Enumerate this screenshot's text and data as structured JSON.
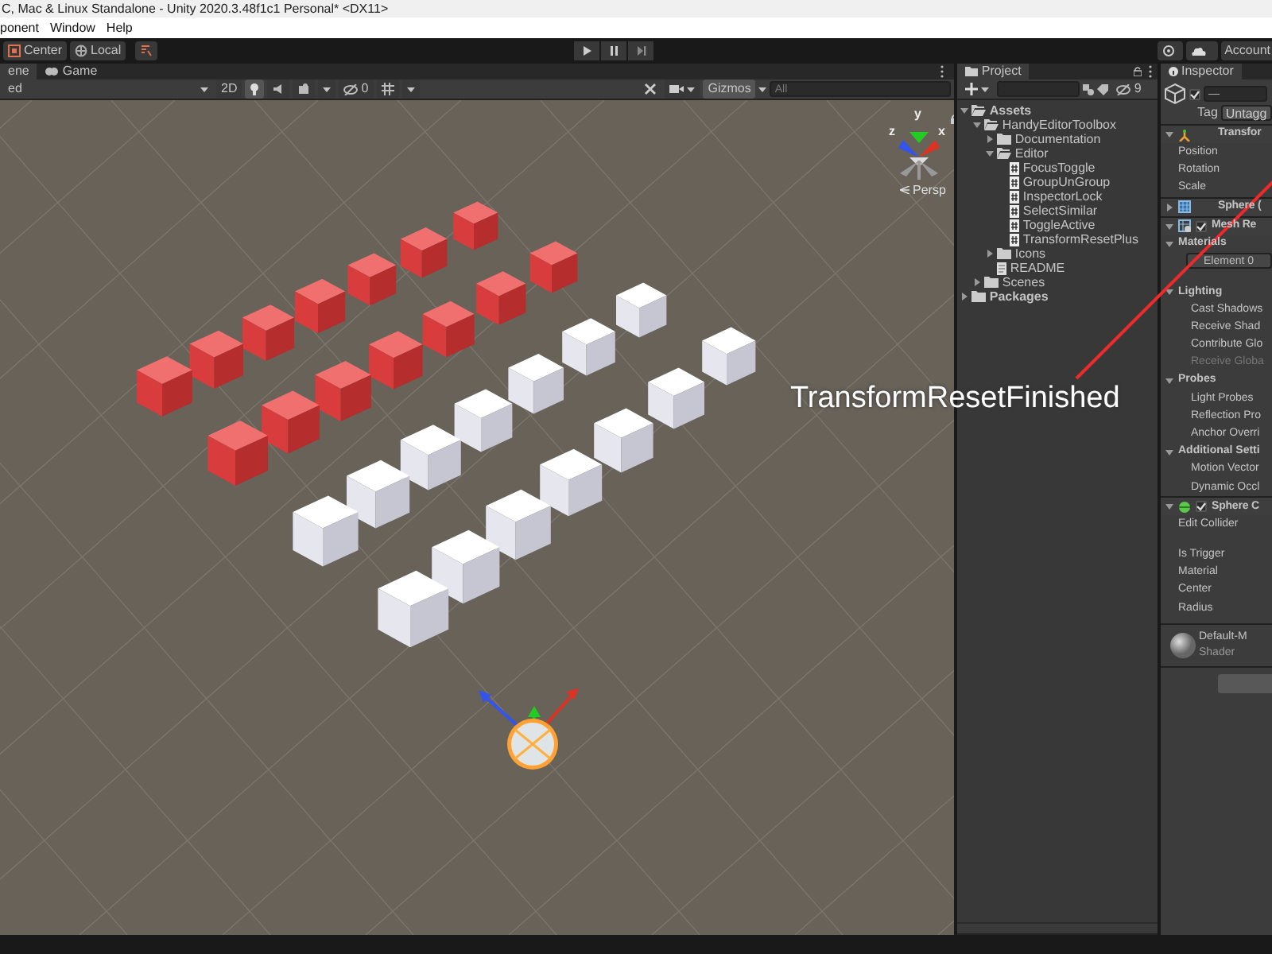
{
  "window": {
    "title": "C, Mac & Linux Standalone - Unity 2020.3.48f1c1 Personal* <DX11>"
  },
  "menu": [
    "ponent",
    "Window",
    "Help"
  ],
  "toolbar": {
    "pivot_buttons": [
      "Center",
      "Local"
    ],
    "account": "Account"
  },
  "scene_tabs": [
    {
      "label": "ene",
      "selected": true
    },
    {
      "label": "Game",
      "selected": false
    }
  ],
  "scene_toolbar": {
    "shading": "ed",
    "mode_2d": "2D",
    "hidden_count": "0",
    "gizmos": "Gizmos",
    "search": {
      "placeholder": "All"
    },
    "toggles": [
      {
        "kind": "lighting",
        "on": true
      },
      {
        "kind": "audio",
        "on": false
      },
      {
        "kind": "effects",
        "on": false
      },
      {
        "kind": "hidden",
        "on": false
      },
      {
        "kind": "grid",
        "on": false
      }
    ]
  },
  "scene_view": {
    "projection": "Persp",
    "axes": [
      "y",
      "z",
      "x"
    ]
  },
  "annotation": {
    "text": "TransformResetFinished"
  },
  "project": {
    "title": "Project",
    "hidden_count": "9",
    "tree": [
      {
        "label": "Assets",
        "kind": "folder",
        "expanded": true,
        "children": [
          {
            "label": "HandyEditorToolbox",
            "kind": "folder",
            "expanded": true,
            "children": [
              {
                "label": "Documentation",
                "kind": "folder",
                "expanded": false
              },
              {
                "label": "Editor",
                "kind": "folder",
                "expanded": true,
                "children": [
                  {
                    "label": "FocusToggle",
                    "kind": "script"
                  },
                  {
                    "label": "GroupUnGroup",
                    "kind": "script"
                  },
                  {
                    "label": "InspectorLock",
                    "kind": "script"
                  },
                  {
                    "label": "SelectSimilar",
                    "kind": "script"
                  },
                  {
                    "label": "ToggleActive",
                    "kind": "script"
                  },
                  {
                    "label": "TransformResetPlus",
                    "kind": "script"
                  }
                ]
              },
              {
                "label": "Icons",
                "kind": "folder",
                "expanded": false
              },
              {
                "label": "README",
                "kind": "doc"
              }
            ]
          },
          {
            "label": "Scenes",
            "kind": "folder",
            "expanded": false
          }
        ]
      },
      {
        "label": "Packages",
        "kind": "folder",
        "expanded": false
      }
    ]
  },
  "inspector": {
    "title": "Inspector",
    "active": true,
    "name_value": "—",
    "tag_label": "Tag",
    "tag_value": "Untagg",
    "rows": [
      {
        "kind": "component",
        "label": "Transfor",
        "expanded": true
      },
      {
        "kind": "property",
        "label": "Position",
        "disabled": false
      },
      {
        "kind": "property",
        "label": "Rotation",
        "disabled": false
      },
      {
        "kind": "property",
        "label": "Scale",
        "disabled": false
      },
      {
        "kind": "component",
        "label": "Sphere (",
        "expanded": false
      },
      {
        "kind": "component",
        "label": "Mesh Re",
        "expanded": true,
        "enabled": true
      },
      {
        "kind": "section",
        "label": "Materials",
        "expanded": true
      },
      {
        "kind": "element",
        "label": "Element 0"
      },
      {
        "kind": "section",
        "label": "Lighting",
        "expanded": true
      },
      {
        "kind": "property",
        "label": "Cast Shadows",
        "disabled": false
      },
      {
        "kind": "property",
        "label": "Receive Shad",
        "disabled": false
      },
      {
        "kind": "property",
        "label": "Contribute Glo",
        "disabled": false
      },
      {
        "kind": "property",
        "label": "Receive Globa",
        "disabled": true
      },
      {
        "kind": "section",
        "label": "Probes",
        "expanded": true
      },
      {
        "kind": "property",
        "label": "Light Probes",
        "disabled": false
      },
      {
        "kind": "property",
        "label": "Reflection Pro",
        "disabled": false
      },
      {
        "kind": "property",
        "label": "Anchor Overri",
        "disabled": false
      },
      {
        "kind": "section",
        "label": "Additional Setti",
        "expanded": true
      },
      {
        "kind": "property",
        "label": "Motion Vector",
        "disabled": false
      },
      {
        "kind": "property",
        "label": "Dynamic Occl",
        "disabled": false
      },
      {
        "kind": "component",
        "label": "Sphere C",
        "expanded": true,
        "enabled": true
      },
      {
        "kind": "property",
        "label": "Edit Collider",
        "disabled": false
      },
      {
        "kind": "property",
        "label": "Is Trigger",
        "disabled": false
      },
      {
        "kind": "property",
        "label": "Material",
        "disabled": false
      },
      {
        "kind": "property",
        "label": "Center",
        "disabled": false
      },
      {
        "kind": "property",
        "label": "Radius",
        "disabled": false
      },
      {
        "kind": "material",
        "label": "Default-M",
        "sub_label": "Shader"
      }
    ]
  }
}
